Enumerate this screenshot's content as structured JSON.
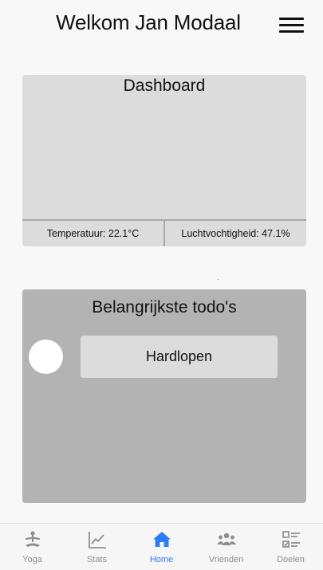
{
  "header": {
    "title": "Welkom Jan Modaal",
    "menu_icon": "hamburger-menu-icon"
  },
  "dashboard": {
    "title": "Dashboard",
    "temperature_label": "Temperatuur: 22.1°C",
    "humidity_label": "Luchtvochtigheid: 47.1%"
  },
  "todos": {
    "title": "Belangrijkste todo's",
    "items": [
      {
        "label": "Hardlopen",
        "done": false
      }
    ]
  },
  "tabbar": {
    "active": "Home",
    "active_color": "#2f7df6",
    "inactive_color": "#8e8e8e",
    "tabs": [
      {
        "label": "Yoga",
        "icon": "yoga-icon"
      },
      {
        "label": "Stats",
        "icon": "line-chart-icon"
      },
      {
        "label": "Home",
        "icon": "home-icon"
      },
      {
        "label": "Vrienden",
        "icon": "friends-icon"
      },
      {
        "label": "Doelen",
        "icon": "checklist-icon"
      }
    ]
  }
}
